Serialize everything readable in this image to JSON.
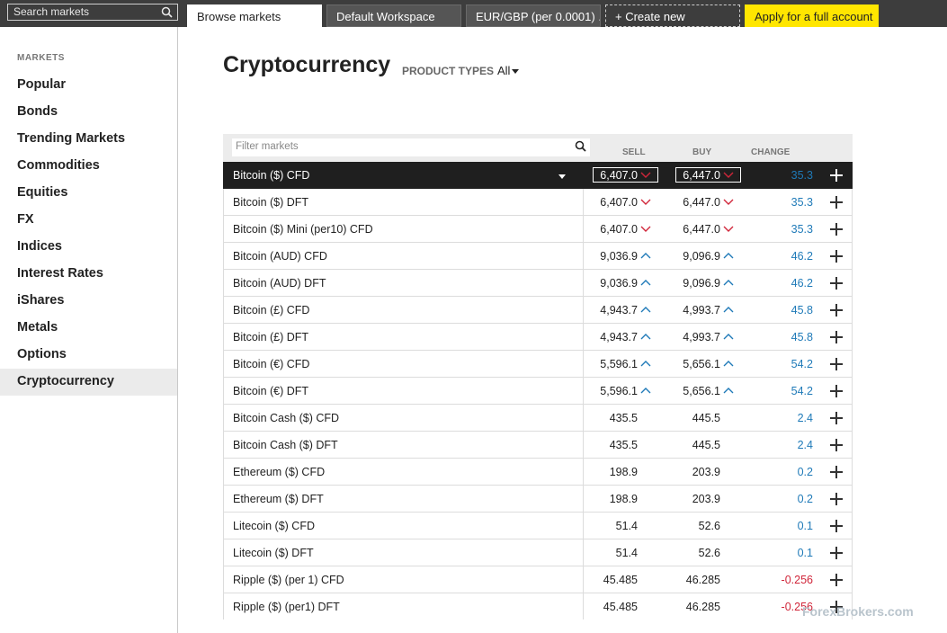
{
  "topbar": {
    "search_placeholder": "Search markets",
    "tabs": [
      {
        "label": "Browse markets"
      },
      {
        "label": "Default Workspace"
      },
      {
        "label": "EUR/GBP (per 0.0001) ..."
      },
      {
        "label": "+ Create new"
      }
    ],
    "apply_label": "Apply for a full account"
  },
  "sidebar": {
    "header": "MARKETS",
    "items": [
      {
        "label": "Popular"
      },
      {
        "label": "Bonds"
      },
      {
        "label": "Trending Markets"
      },
      {
        "label": "Commodities"
      },
      {
        "label": "Equities"
      },
      {
        "label": "FX"
      },
      {
        "label": "Indices"
      },
      {
        "label": "Interest Rates"
      },
      {
        "label": "iShares"
      },
      {
        "label": "Metals"
      },
      {
        "label": "Options"
      },
      {
        "label": "Cryptocurrency"
      }
    ]
  },
  "main": {
    "title": "Cryptocurrency",
    "product_types_label": "PRODUCT TYPES",
    "product_types_value": "All",
    "filter_placeholder": "Filter markets",
    "columns": {
      "sell": "SELL",
      "buy": "BUY",
      "change": "CHANGE"
    },
    "rows": [
      {
        "name": "Bitcoin ($) CFD",
        "sell": "6,407.0",
        "buy": "6,447.0",
        "change": "35.3",
        "dir": "down"
      },
      {
        "name": "Bitcoin ($) DFT",
        "sell": "6,407.0",
        "buy": "6,447.0",
        "change": "35.3",
        "dir": "down"
      },
      {
        "name": "Bitcoin ($) Mini (per10) CFD",
        "sell": "6,407.0",
        "buy": "6,447.0",
        "change": "35.3",
        "dir": "down"
      },
      {
        "name": "Bitcoin (AUD) CFD",
        "sell": "9,036.9",
        "buy": "9,096.9",
        "change": "46.2",
        "dir": "up"
      },
      {
        "name": "Bitcoin (AUD) DFT",
        "sell": "9,036.9",
        "buy": "9,096.9",
        "change": "46.2",
        "dir": "up"
      },
      {
        "name": "Bitcoin (£) CFD",
        "sell": "4,943.7",
        "buy": "4,993.7",
        "change": "45.8",
        "dir": "up"
      },
      {
        "name": "Bitcoin (£) DFT",
        "sell": "4,943.7",
        "buy": "4,993.7",
        "change": "45.8",
        "dir": "up"
      },
      {
        "name": "Bitcoin (€) CFD",
        "sell": "5,596.1",
        "buy": "5,656.1",
        "change": "54.2",
        "dir": "up"
      },
      {
        "name": "Bitcoin (€) DFT",
        "sell": "5,596.1",
        "buy": "5,656.1",
        "change": "54.2",
        "dir": "up"
      },
      {
        "name": "Bitcoin Cash ($) CFD",
        "sell": "435.5",
        "buy": "445.5",
        "change": "2.4",
        "dir": "none"
      },
      {
        "name": "Bitcoin Cash ($) DFT",
        "sell": "435.5",
        "buy": "445.5",
        "change": "2.4",
        "dir": "none"
      },
      {
        "name": "Ethereum ($) CFD",
        "sell": "198.9",
        "buy": "203.9",
        "change": "0.2",
        "dir": "none"
      },
      {
        "name": "Ethereum ($) DFT",
        "sell": "198.9",
        "buy": "203.9",
        "change": "0.2",
        "dir": "none"
      },
      {
        "name": "Litecoin ($) CFD",
        "sell": "51.4",
        "buy": "52.6",
        "change": "0.1",
        "dir": "none"
      },
      {
        "name": "Litecoin ($) DFT",
        "sell": "51.4",
        "buy": "52.6",
        "change": "0.1",
        "dir": "none"
      },
      {
        "name": "Ripple ($) (per 1) CFD",
        "sell": "45.485",
        "buy": "46.285",
        "change": "-0.256",
        "dir": "none"
      },
      {
        "name": "Ripple ($) (per1) DFT",
        "sell": "45.485",
        "buy": "46.285",
        "change": "-0.256",
        "dir": "none"
      }
    ]
  },
  "colors": {
    "up": "#1f7ab8",
    "down": "#d0263a",
    "apply": "#ffe600"
  },
  "watermark": "ForexBrokers.com"
}
